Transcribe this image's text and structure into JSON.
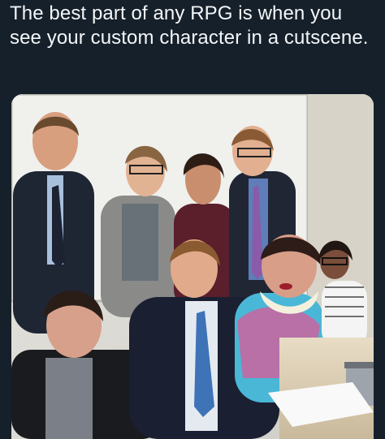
{
  "post": {
    "text": "The best part of any RPG is when you see your custom character in a cutscene."
  },
  "media": {
    "type": "photo"
  }
}
